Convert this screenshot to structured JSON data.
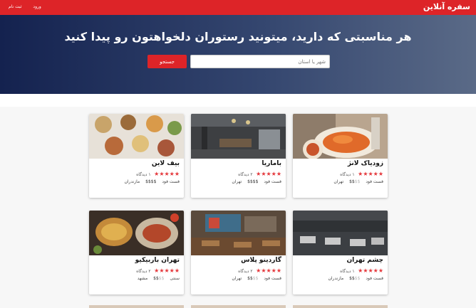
{
  "nav": {
    "brand": "سفره آنلاین",
    "signup": "ثبت نام",
    "login": "ورود"
  },
  "hero": {
    "title": "هر مناسبتی که دارید، میتونید رستوران دلخواهتون رو پیدا کنید",
    "search_placeholder": "شهر یا استان",
    "search_button": "جستجو"
  },
  "restaurants": [
    {
      "name": "زودیاک لانژ",
      "reviews": "۱ دیدگاه",
      "cuisine": "فست فود",
      "price_on": "$$",
      "price_off": "$$",
      "city": "تهران",
      "stars": 5
    },
    {
      "name": "باماریا",
      "reviews": "۲ دیدگاه",
      "cuisine": "فست فود",
      "price_on": "$$$$",
      "price_off": "",
      "city": "تهران",
      "stars": 5
    },
    {
      "name": "بیف لاین",
      "reviews": "۱ دیدگاه",
      "cuisine": "فست فود",
      "price_on": "$$$$",
      "price_off": "",
      "city": "مازندران",
      "stars": 5
    },
    {
      "name": "چشم تهران",
      "reviews": "۱ دیدگاه",
      "cuisine": "فست فود",
      "price_on": "$$",
      "price_off": "$$",
      "city": "مازندران",
      "stars": 5
    },
    {
      "name": "گاردینو پلاس",
      "reviews": "۲ دیدگاه",
      "cuisine": "فست فود",
      "price_on": "$$",
      "price_off": "$$",
      "city": "تهران",
      "stars": 5
    },
    {
      "name": "تهران باربیکیو",
      "reviews": "۲ دیدگاه",
      "cuisine": "سنتی",
      "price_on": "$$",
      "price_off": "$$",
      "city": "مشهد",
      "stars": 5
    }
  ],
  "icons": {
    "star": "star-icon"
  },
  "colors": {
    "brand_red": "#dd2428",
    "hero_dark": "#14224f",
    "star_red": "#e4363a"
  }
}
